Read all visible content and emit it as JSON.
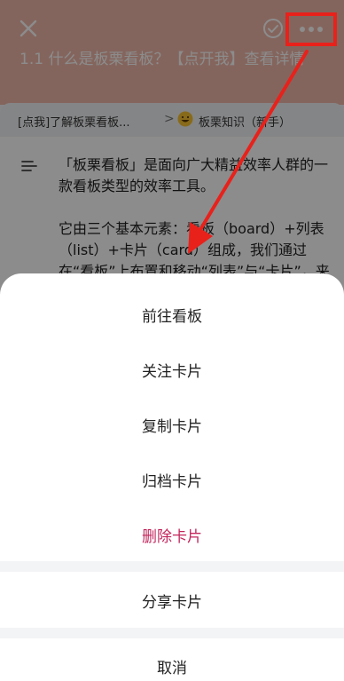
{
  "header": {
    "title": "1.1 什么是板栗看板？【点开我】查看详情",
    "bg_color": "#f0b9aa"
  },
  "breadcrumb": {
    "board": "[点我]了解板栗看板...",
    "separator": ">",
    "list": "板栗知识（新手）"
  },
  "description": {
    "paragraph1": "「板栗看板」是面向广大精益效率人群的一款看板类型的效率工具。",
    "paragraph2": "它由三个基本元素：看板（board）+列表（list）+卡片（card）组成，我们通过在“看板”上布置和移动“列表”与“卡片”，来明晰进度、整理信息。"
  },
  "action_sheet": {
    "items": [
      {
        "label": "前往看板"
      },
      {
        "label": "关注卡片"
      },
      {
        "label": "复制卡片"
      },
      {
        "label": "归档卡片"
      },
      {
        "label": "删除卡片",
        "color": "#c2255c"
      }
    ],
    "share": "分享卡片",
    "cancel": "取消"
  },
  "annotation": {
    "color": "#e8211b"
  }
}
